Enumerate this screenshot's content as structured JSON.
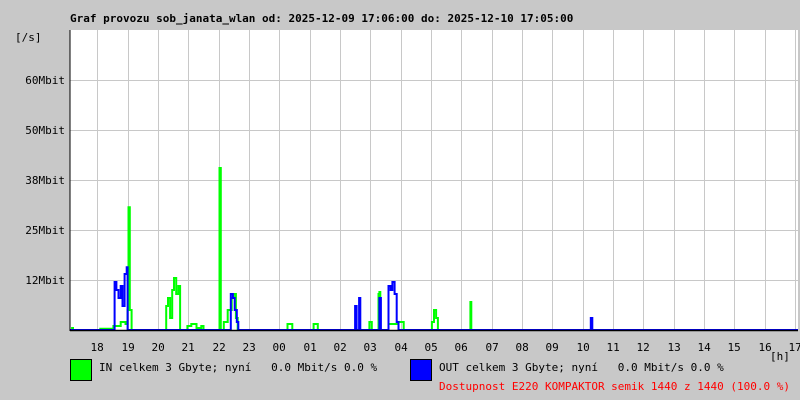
{
  "chart_data": {
    "type": "line",
    "title": "Graf provozu sob_janata_wlan od: 2025-12-09 17:06:00 do: 2025-12-10 17:05:00",
    "ylabel": "[/s]",
    "xlabel": "[h]",
    "ylim": [
      0,
      75
    ],
    "xlim_hours_from_start": [
      0,
      24
    ],
    "y_ticks": [
      {
        "v": 12.5,
        "label": "12Mbit"
      },
      {
        "v": 25,
        "label": "25Mbit"
      },
      {
        "v": 37.5,
        "label": "38Mbit"
      },
      {
        "v": 50,
        "label": "50Mbit"
      },
      {
        "v": 62.5,
        "label": "60Mbit"
      }
    ],
    "x_ticks": [
      "18",
      "19",
      "20",
      "21",
      "22",
      "23",
      "00",
      "01",
      "02",
      "03",
      "04",
      "05",
      "06",
      "07",
      "08",
      "09",
      "10",
      "11",
      "12",
      "13",
      "14",
      "15",
      "16",
      "17"
    ],
    "first_tick_offset_hours": 0.9,
    "grid": true,
    "series": [
      {
        "name": "IN",
        "color": "#00ff00",
        "points": [
          [
            0,
            0
          ],
          [
            0.07,
            0.5
          ],
          [
            0.1,
            0
          ],
          [
            1.0,
            0.3
          ],
          [
            1.43,
            1
          ],
          [
            1.67,
            2
          ],
          [
            1.83,
            1.5
          ],
          [
            1.9,
            5
          ],
          [
            1.93,
            30.7
          ],
          [
            1.97,
            5
          ],
          [
            2.03,
            0
          ],
          [
            3.17,
            6
          ],
          [
            3.23,
            8
          ],
          [
            3.3,
            3
          ],
          [
            3.37,
            10
          ],
          [
            3.43,
            13
          ],
          [
            3.5,
            9
          ],
          [
            3.57,
            11
          ],
          [
            3.63,
            0
          ],
          [
            3.87,
            1
          ],
          [
            4.0,
            1.5
          ],
          [
            4.17,
            0.5
          ],
          [
            4.33,
            1
          ],
          [
            4.4,
            0
          ],
          [
            4.9,
            0
          ],
          [
            4.93,
            40.5
          ],
          [
            4.97,
            0
          ],
          [
            5.07,
            2
          ],
          [
            5.2,
            5
          ],
          [
            5.33,
            8
          ],
          [
            5.4,
            9
          ],
          [
            5.47,
            3
          ],
          [
            5.53,
            0
          ],
          [
            7.17,
            1.5
          ],
          [
            7.33,
            0
          ],
          [
            8.03,
            1.5
          ],
          [
            8.17,
            0
          ],
          [
            9.87,
            2
          ],
          [
            9.95,
            0
          ],
          [
            10.17,
            9
          ],
          [
            10.2,
            9.5
          ],
          [
            10.23,
            0
          ],
          [
            10.5,
            1.5
          ],
          [
            10.83,
            2
          ],
          [
            11.0,
            0
          ],
          [
            11.93,
            2
          ],
          [
            12.0,
            5
          ],
          [
            12.07,
            3
          ],
          [
            12.13,
            0
          ],
          [
            13.2,
            7
          ],
          [
            13.23,
            0
          ],
          [
            24,
            0
          ]
        ]
      },
      {
        "name": "OUT",
        "color": "#0000ff",
        "points": [
          [
            0,
            0
          ],
          [
            1.43,
            0
          ],
          [
            1.47,
            12
          ],
          [
            1.53,
            10
          ],
          [
            1.6,
            8
          ],
          [
            1.67,
            11
          ],
          [
            1.73,
            6
          ],
          [
            1.8,
            14
          ],
          [
            1.87,
            15.7
          ],
          [
            1.9,
            0
          ],
          [
            5.3,
            9
          ],
          [
            5.37,
            8
          ],
          [
            5.43,
            5
          ],
          [
            5.5,
            2
          ],
          [
            5.55,
            0
          ],
          [
            9.4,
            6
          ],
          [
            9.45,
            0
          ],
          [
            9.53,
            8
          ],
          [
            9.57,
            0
          ],
          [
            10.2,
            8
          ],
          [
            10.25,
            0
          ],
          [
            10.5,
            11
          ],
          [
            10.57,
            10
          ],
          [
            10.63,
            12
          ],
          [
            10.7,
            9
          ],
          [
            10.77,
            2
          ],
          [
            10.83,
            0
          ],
          [
            17.17,
            3
          ],
          [
            17.22,
            0
          ],
          [
            24,
            0
          ]
        ]
      }
    ]
  },
  "legend": {
    "in": {
      "text": "IN celkem 3 Gbyte; nyní   0.0 Mbit/s 0.0 %",
      "color": "#00ff00"
    },
    "out": {
      "text": "OUT celkem 3 Gbyte; nyní   0.0 Mbit/s 0.0 %",
      "color": "#0000ff"
    },
    "availability": {
      "text": "Dostupnost E220 KOMPAKTOR semik 1440 z 1440 (100.0 %)",
      "color": "#ff0000"
    }
  }
}
